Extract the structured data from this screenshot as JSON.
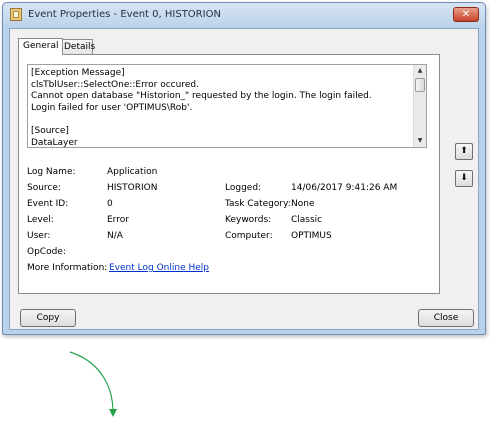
{
  "window": {
    "title": "Event Properties - Event 0, HISTORION",
    "close_glyph": "✕"
  },
  "tabs": [
    {
      "label": "General",
      "selected": true
    },
    {
      "label": "Details",
      "selected": false
    }
  ],
  "message": {
    "lines": [
      "[Exception Message]",
      "clsTblUser::SelectOne::Error occured.",
      "Cannot open database \"Historion_\" requested by the login. The login failed.",
      "Login failed for user 'OPTIMUS\\Rob'.",
      "",
      "[Source]",
      "DataLayer"
    ],
    "scroll_up_glyph": "▲",
    "scroll_down_glyph": "▼"
  },
  "fields": {
    "log_name": {
      "label": "Log Name:",
      "value": "Application"
    },
    "source": {
      "label": "Source:",
      "value": "HISTORION"
    },
    "logged": {
      "label": "Logged:",
      "value": "14/06/2017 9:41:26 AM"
    },
    "event_id": {
      "label": "Event ID:",
      "value": "0"
    },
    "task_category": {
      "label": "Task Category:",
      "value": "None"
    },
    "level": {
      "label": "Level:",
      "value": "Error"
    },
    "keywords": {
      "label": "Keywords:",
      "value": "Classic"
    },
    "user": {
      "label": "User:",
      "value": "N/A"
    },
    "computer": {
      "label": "Computer:",
      "value": "OPTIMUS"
    },
    "opcode": {
      "label": "OpCode:",
      "value": ""
    },
    "more_info": {
      "label": "More Information:",
      "link": "Event Log Online Help"
    }
  },
  "side_buttons": {
    "up_glyph": "⬆",
    "down_glyph": "⬇"
  },
  "buttons": {
    "copy": "Copy",
    "close": "Close"
  },
  "colors": {
    "arrow": "#22a34a",
    "link": "#0033cc",
    "frame": "#b9d1ea"
  },
  "icons": {
    "app": "event-viewer-icon",
    "close": "close-icon",
    "up": "arrow-up-icon",
    "down": "arrow-down-icon"
  }
}
